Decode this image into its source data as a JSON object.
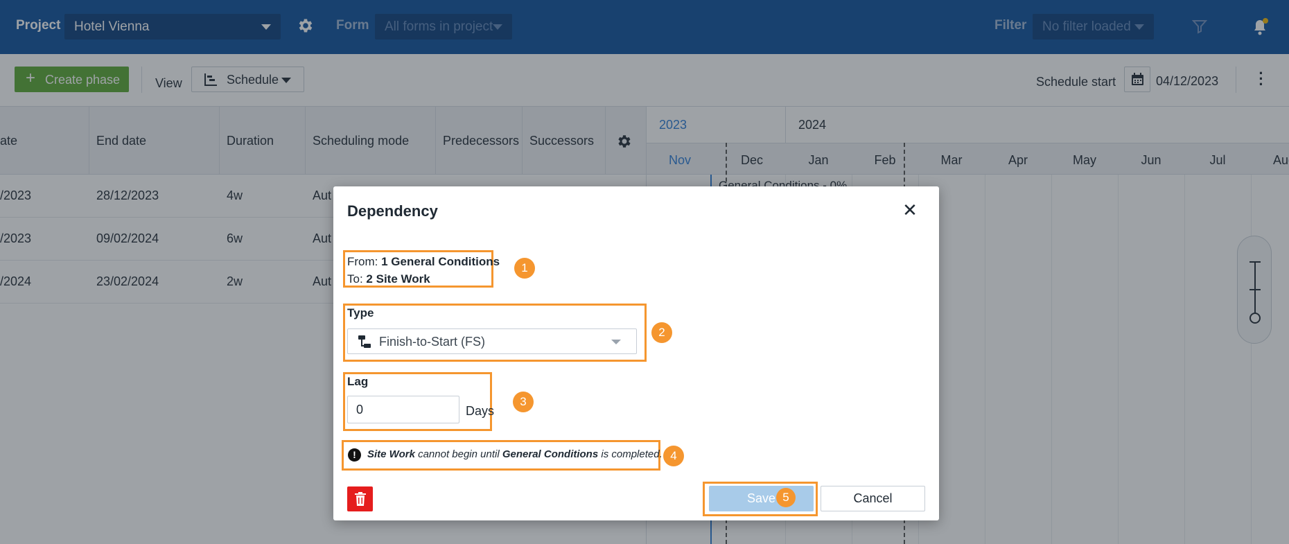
{
  "topbar": {
    "project_label": "Project",
    "project_value": "Hotel Vienna",
    "form_label": "Form",
    "form_value": "All forms in project",
    "filter_label": "Filter",
    "filter_value": "No filter loaded",
    "bg_color": "#0b4f9b",
    "notification_dot_color": "#f2b705"
  },
  "toolbar": {
    "create_label": "Create phase",
    "view_label": "View",
    "view_value": "Schedule",
    "schedule_start_label": "Schedule start",
    "schedule_start_value": "04/12/2023"
  },
  "table": {
    "columns": [
      "ate",
      "End date",
      "Duration",
      "Scheduling mode",
      "Predecessors",
      "Successors"
    ],
    "rows": [
      {
        "start": "/2023",
        "end": "28/12/2023",
        "duration": "4w",
        "mode": "Aut"
      },
      {
        "start": "/2023",
        "end": "09/02/2024",
        "duration": "6w",
        "mode": "Aut"
      },
      {
        "start": "/2024",
        "end": "23/02/2024",
        "duration": "2w",
        "mode": "Aut"
      }
    ]
  },
  "gantt": {
    "years": [
      "2023",
      "2024"
    ],
    "months": [
      "Nov",
      "Dec",
      "Jan",
      "Feb",
      "Mar",
      "Apr",
      "May",
      "Jun",
      "Jul",
      "Aug"
    ],
    "bar_label": "General Conditions - 0%"
  },
  "dialog": {
    "title": "Dependency",
    "from_label": "From:",
    "from_value": "1 General Conditions",
    "to_label": "To:",
    "to_value": "2 Site Work",
    "type_label": "Type",
    "type_value": "Finish-to-Start (FS)",
    "lag_label": "Lag",
    "lag_value": "0",
    "lag_unit": "Days",
    "warning_subject": "Site Work",
    "warning_mid": "cannot begin until",
    "warning_object": "General Conditions",
    "warning_end": "is completed.",
    "save_label": "Save",
    "cancel_label": "Cancel",
    "delete_color": "#e51d1d",
    "highlight_color": "#f5962f",
    "badges": [
      "1",
      "2",
      "3",
      "4",
      "5"
    ]
  }
}
